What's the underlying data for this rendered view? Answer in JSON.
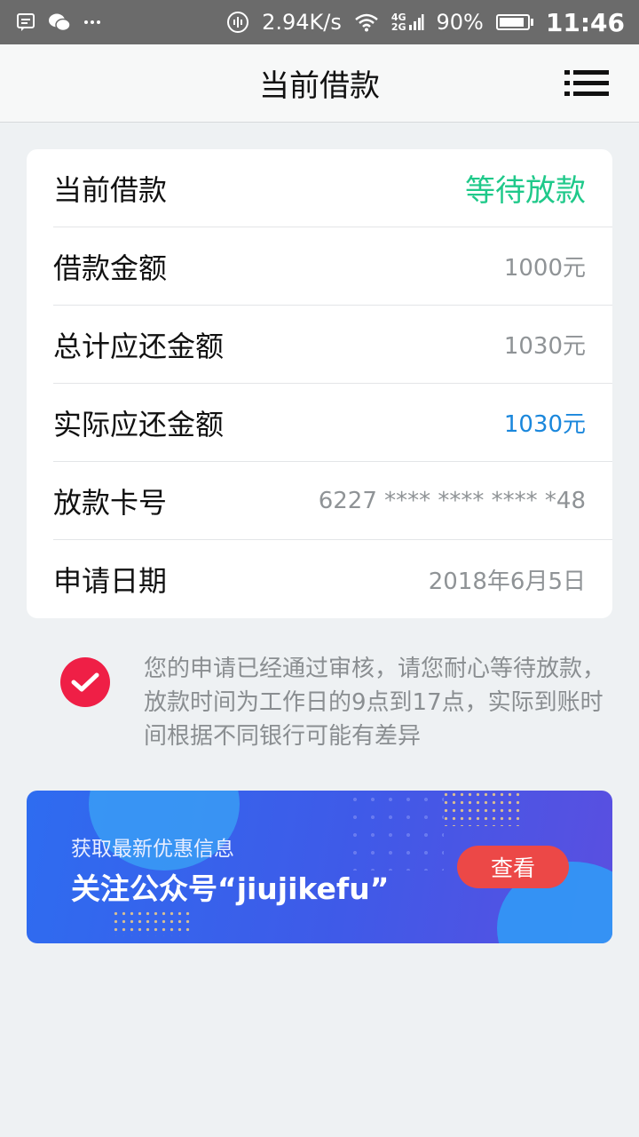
{
  "status_bar": {
    "net_speed": "2.94K/s",
    "net_4g": "4G",
    "net_2g": "2G",
    "battery_text": "90%",
    "battery_level": 0.9,
    "time": "11:46"
  },
  "header": {
    "title": "当前借款"
  },
  "loan": {
    "rows": [
      {
        "label": "当前借款",
        "value": "等待放款"
      },
      {
        "label": "借款金额",
        "value": "1000元"
      },
      {
        "label": "总计应还金额",
        "value": "1030元"
      },
      {
        "label": "实际应还金额",
        "value": "1030元"
      },
      {
        "label": "放款卡号",
        "value": "6227 **** **** **** *48"
      },
      {
        "label": "申请日期",
        "value": "2018年6月5日"
      }
    ]
  },
  "notice": {
    "text": "您的申请已经通过审核，请您耐心等待放款，放款时间为工作日的9点到17点，实际到账时间根据不同银行可能有差异"
  },
  "banner": {
    "subtitle": "获取最新优惠信息",
    "title": "关注公众号“jiujikefu”",
    "button_label": "查看"
  },
  "colors": {
    "status_green": "#1fc98a",
    "amount_blue": "#1a87dc",
    "check_red": "#ef1f46",
    "banner_button": "#ec4847"
  }
}
